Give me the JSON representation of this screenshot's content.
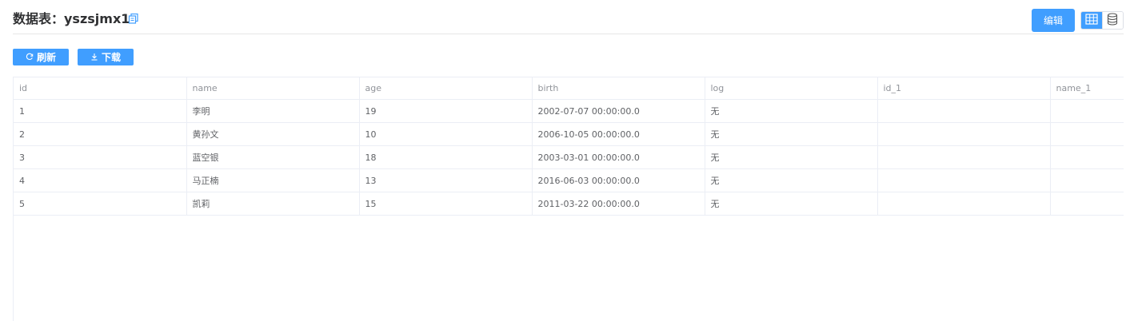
{
  "header": {
    "title": "数据表：yszsjmx1",
    "edit_label": "编辑"
  },
  "toolbar": {
    "refresh_label": "刷新",
    "download_label": "下载"
  },
  "icons": {
    "copy": "copy-icon",
    "refresh": "refresh-icon",
    "download": "download-icon",
    "table_view": "table-grid-icon",
    "database_view": "database-icon"
  },
  "colors": {
    "primary": "#409eff",
    "header_text": "#909399",
    "cell_text": "#606266",
    "border": "#ebeef5"
  },
  "table": {
    "columns": [
      "id",
      "name",
      "age",
      "birth",
      "log",
      "id_1",
      "name_1"
    ],
    "rows": [
      [
        "1",
        "李明",
        "19",
        "2002-07-07 00:00:00.0",
        "无",
        "",
        ""
      ],
      [
        "2",
        "黄孙文",
        "10",
        "2006-10-05 00:00:00.0",
        "无",
        "",
        ""
      ],
      [
        "3",
        "蓝空银",
        "18",
        "2003-03-01 00:00:00.0",
        "无",
        "",
        ""
      ],
      [
        "4",
        "马正楠",
        "13",
        "2016-06-03 00:00:00.0",
        "无",
        "",
        ""
      ],
      [
        "5",
        "凯莉",
        "15",
        "2011-03-22 00:00:00.0",
        "无",
        "",
        ""
      ]
    ]
  }
}
